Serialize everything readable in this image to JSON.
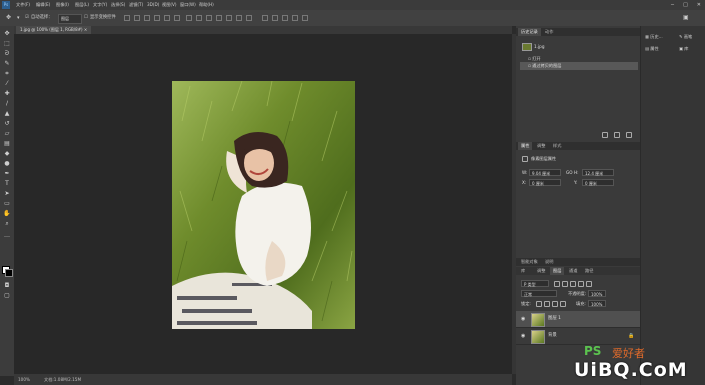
{
  "menu": [
    "文件(F)",
    "编辑(E)",
    "图像(I)",
    "图层(L)",
    "文字(Y)",
    "选择(S)",
    "滤镜(T)",
    "3D(D)",
    "视图(V)",
    "窗口(W)",
    "帮助(H)"
  ],
  "window_controls": [
    "─",
    "□",
    "✕"
  ],
  "options": {
    "auto_select": "自动选择：",
    "auto_select_value": "图层",
    "show_transform": "显示变换控件"
  },
  "document_tab": "1.jpg @ 100% (图层 1, RGB/8#) ×",
  "status": {
    "zoom": "100%",
    "doc": "文档:1.08M/2.15M"
  },
  "history": {
    "tabs": [
      "历史记录",
      "动作"
    ],
    "snapshot": "1.jpg",
    "items": [
      "打开",
      "通过拷贝的图层"
    ]
  },
  "properties": {
    "tabs": [
      "属性",
      "调整",
      "样式"
    ],
    "title": "像素图层属性",
    "w_label": "W:",
    "w_value": "9.04 厘米",
    "h_label": "H:",
    "h_value": "12.4 厘米",
    "x_label": "X:",
    "x_value": "0 厘米",
    "y_label": "Y:",
    "y_value": "0 厘米",
    "link": "GO"
  },
  "layers": {
    "top_tabs": [
      "库",
      "调整",
      "图层",
      "通道",
      "路径"
    ],
    "group_tabs": [
      "智能对象",
      "说明"
    ],
    "filter_label": "P 类型",
    "blend_mode": "正常",
    "opacity_label": "不透明度:",
    "opacity_value": "100%",
    "lock_label": "锁定:",
    "fill_label": "填充:",
    "fill_value": "100%",
    "rows": [
      {
        "name": "图层 1",
        "selected": true
      },
      {
        "name": "背景",
        "selected": false
      }
    ]
  },
  "dock": [
    {
      "icon": "history-icon",
      "label": "历史..."
    },
    {
      "icon": "properties-icon",
      "label": "属性"
    },
    {
      "icon": "brush-icon",
      "label": "画笔"
    },
    {
      "icon": "library-icon",
      "label": "库"
    }
  ],
  "tools": [
    "move-tool-icon",
    "marquee-tool-icon",
    "lasso-tool-icon",
    "quick-select-tool-icon",
    "crop-tool-icon",
    "eyedropper-tool-icon",
    "healing-brush-icon",
    "brush-tool-icon",
    "clone-stamp-icon",
    "history-brush-icon",
    "eraser-tool-icon",
    "gradient-tool-icon",
    "blur-tool-icon",
    "dodge-tool-icon",
    "pen-tool-icon",
    "type-tool-icon",
    "path-select-icon",
    "shape-tool-icon",
    "hand-tool-icon",
    "zoom-tool-icon"
  ],
  "watermark": {
    "ps": "PS",
    "chinese": "爱好者",
    "brand": "UiBQ.CoM"
  },
  "colors": {
    "panel": "#3a3a3a",
    "canvas": "#282828",
    "selection": "#585858"
  }
}
